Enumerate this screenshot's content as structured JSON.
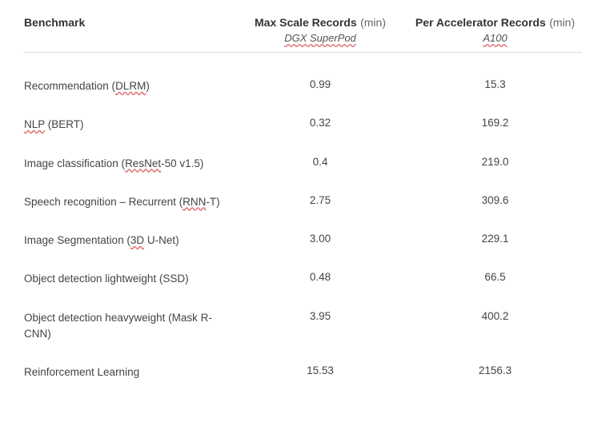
{
  "headers": {
    "benchmark": "Benchmark",
    "max_scale": "Max Scale Records",
    "max_scale_unit": "(min)",
    "max_scale_sub": "DGX SuperPod",
    "per_accel": "Per Accelerator Records",
    "per_accel_unit": "(min)",
    "per_accel_sub": "A100"
  },
  "rows": [
    {
      "name_html": "Recommendation (<span class='spellcheck'>DLRM</span>)",
      "max": "0.99",
      "per": "15.3"
    },
    {
      "name_html": "<span class='spellcheck'>NLP</span> (BERT)",
      "max": "0.32",
      "per": "169.2"
    },
    {
      "name_html": "Image classification (<span class='spellcheck'>ResNet</span>-50 v1.5)",
      "max": "0.4",
      "per": "219.0"
    },
    {
      "name_html": "Speech recognition – Recurrent (<span class='spellcheck'>RNN</span>-T)",
      "max": "2.75",
      "per": "309.6"
    },
    {
      "name_html": "Image Segmentation (<span class='spellcheck'>3D</span> U-Net)",
      "max": "3.00",
      "per": "229.1"
    },
    {
      "name_html": "Object detection lightweight (SSD)",
      "max": "0.48",
      "per": "66.5"
    },
    {
      "name_html": "Object detection heavyweight (Mask R-CNN)",
      "max": "3.95",
      "per": "400.2"
    },
    {
      "name_html": "Reinforcement Learning",
      "max": "15.53",
      "per": "2156.3"
    }
  ]
}
